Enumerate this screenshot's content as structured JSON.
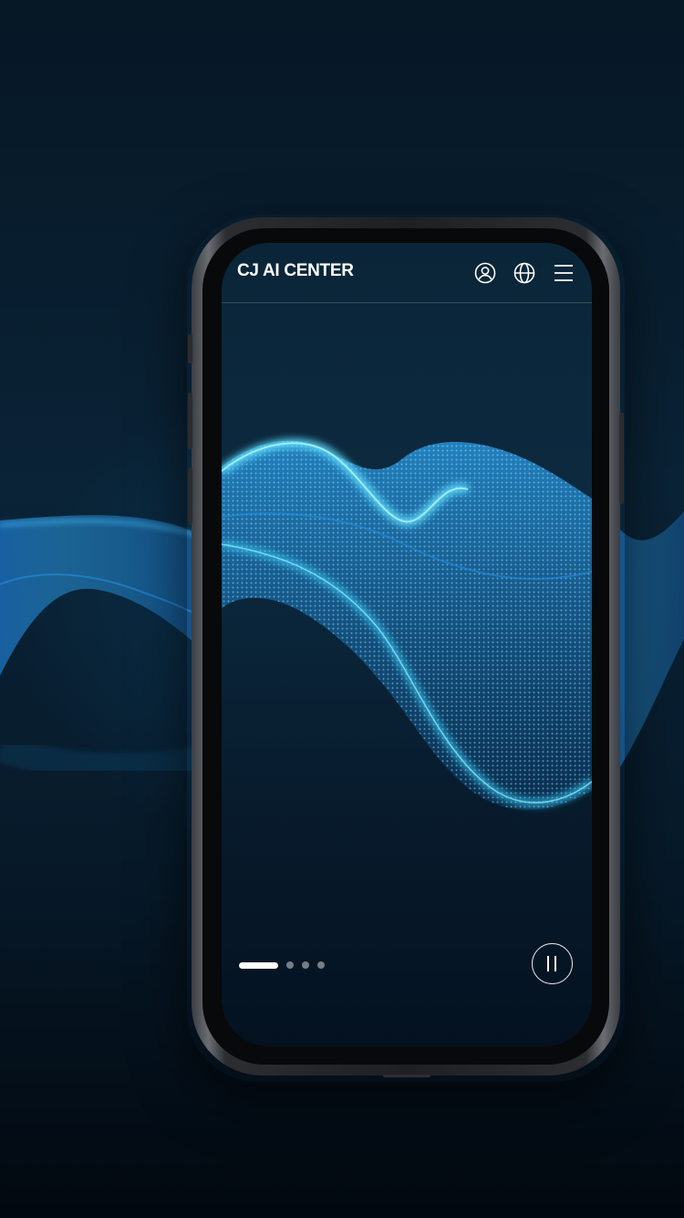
{
  "header": {
    "logo_text": "CJ AI CENTER",
    "icons": {
      "account": "user-circle-icon",
      "language": "globe-icon",
      "menu": "hamburger-menu-icon"
    }
  },
  "hero": {
    "slide_count": 4,
    "active_slide": 1,
    "playback_control": "pause-icon"
  },
  "colors": {
    "background": "#04111d",
    "wave_glow": "#34c8f0",
    "wave_deep": "#1a7fd0",
    "text": "#ffffff"
  }
}
